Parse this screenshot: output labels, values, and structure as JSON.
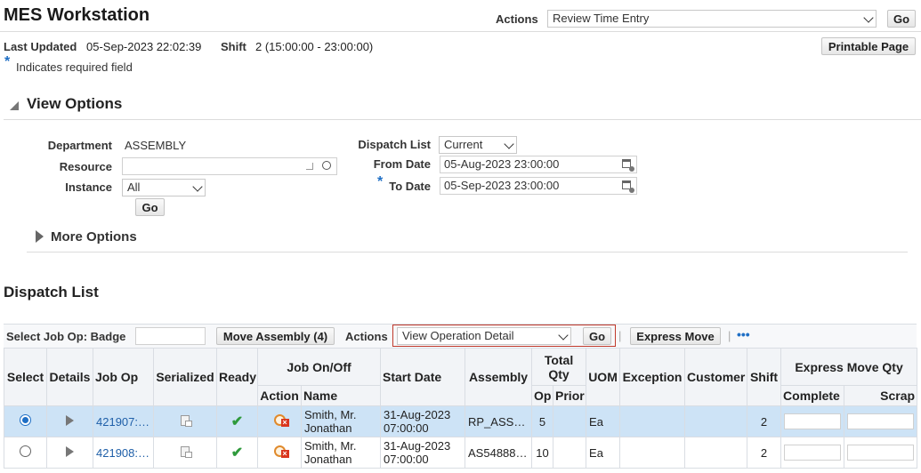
{
  "header": {
    "title": "MES Workstation",
    "actions_label": "Actions",
    "actions_value": "Review Time Entry",
    "go_label": "Go",
    "last_updated_label": "Last Updated",
    "last_updated_value": "05-Sep-2023 22:02:39",
    "shift_label": "Shift",
    "shift_value": "2 (15:00:00 - 23:00:00)",
    "printable_label": "Printable Page",
    "required_star": "*",
    "required_note": "Indicates required field"
  },
  "view_options": {
    "title": "View Options",
    "department_label": "Department",
    "department_value": "ASSEMBLY",
    "resource_label": "Resource",
    "resource_value": "",
    "instance_label": "Instance",
    "instance_value": "All",
    "go_label": "Go",
    "dispatch_list_label": "Dispatch List",
    "dispatch_list_value": "Current",
    "from_date_label": "From Date",
    "from_date_value": "05-Aug-2023 23:00:00",
    "to_date_label": "To Date",
    "to_date_value": "05-Sep-2023 23:00:00",
    "more_options_label": "More Options"
  },
  "dispatch": {
    "title": "Dispatch List",
    "select_job_op_label": "Select Job Op: Badge",
    "badge_value": "",
    "move_assembly_label": "Move Assembly (4)",
    "actions_label": "Actions",
    "actions_value": "View Operation Detail",
    "go_label": "Go",
    "separator": "|",
    "express_move_label": "Express Move",
    "more_label": "•••",
    "columns": {
      "select": "Select",
      "details": "Details",
      "job_op": "Job Op",
      "serialized": "Serialized",
      "ready": "Ready",
      "job_on_off": "Job On/Off",
      "action": "Action",
      "name": "Name",
      "start_date": "Start Date",
      "assembly": "Assembly",
      "total_qty": "Total Qty",
      "op": "Op",
      "prior": "Prior",
      "uom": "UOM",
      "exception": "Exception",
      "customer": "Customer",
      "shift": "Shift",
      "express_move_qty": "Express Move Qty",
      "complete": "Complete",
      "scrap": "Scrap"
    },
    "rows": [
      {
        "job_op": "421907:…",
        "ready": "✔",
        "name": "Smith, Mr. Jonathan",
        "start_date": "31-Aug-2023 07:00:00",
        "assembly": "RP_ASS…",
        "op": "5",
        "prior": "",
        "uom": "Ea",
        "exception": "",
        "customer": "",
        "shift": "2",
        "complete": "",
        "scrap": "",
        "selected": true
      },
      {
        "job_op": "421908:…",
        "ready": "✔",
        "name": "Smith, Mr. Jonathan",
        "start_date": "31-Aug-2023 07:00:00",
        "assembly": "AS54888…",
        "op": "10",
        "prior": "",
        "uom": "Ea",
        "exception": "",
        "customer": "",
        "shift": "2",
        "complete": "",
        "scrap": "",
        "selected": false
      }
    ]
  },
  "colors": {
    "accent": "#1f6fc5",
    "selected_row": "#cde3f6",
    "highlight_border": "#c0392b",
    "link": "#1f5fa8"
  }
}
